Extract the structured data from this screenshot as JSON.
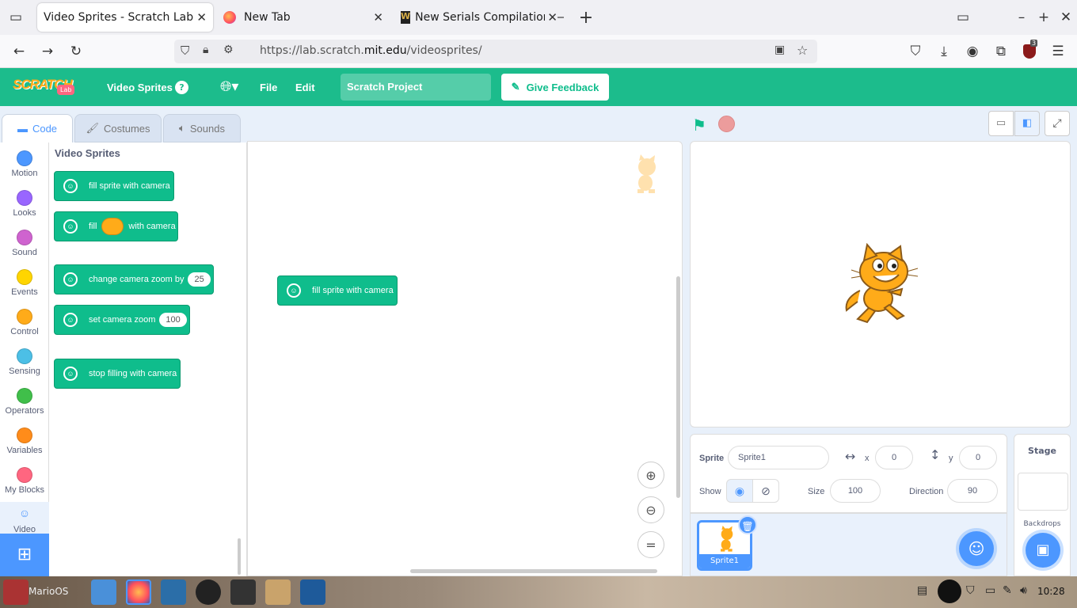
{
  "browser": {
    "tabs": [
      {
        "label": "Video Sprites - Scratch Lab",
        "active": true
      },
      {
        "label": "New Tab",
        "active": false
      },
      {
        "label": "New Serials Compilation — ",
        "active": false
      }
    ],
    "url_prefix": "https://lab.scratch.",
    "url_domain": "mit.edu",
    "url_path": "/videosprites/",
    "extension_badge": "3"
  },
  "menu": {
    "logo_text": "SCRATCH",
    "logo_badge": "Lab",
    "project_label": "Video Sprites",
    "help": "?",
    "file": "File",
    "edit": "Edit",
    "project_title": "Scratch Project",
    "feedback": "Give Feedback"
  },
  "editor_tabs": {
    "code": "Code",
    "costumes": "Costumes",
    "sounds": "Sounds"
  },
  "categories": [
    {
      "label": "Motion",
      "color": "#4c97ff"
    },
    {
      "label": "Looks",
      "color": "#9966ff"
    },
    {
      "label": "Sound",
      "color": "#cf63cf"
    },
    {
      "label": "Events",
      "color": "#ffd500"
    },
    {
      "label": "Control",
      "color": "#ffab19"
    },
    {
      "label": "Sensing",
      "color": "#4cbfe6"
    },
    {
      "label": "Operators",
      "color": "#40bf4a"
    },
    {
      "label": "Variables",
      "color": "#ff8c1a"
    },
    {
      "label": "My Blocks",
      "color": "#ff6680"
    },
    {
      "label": "Video",
      "color": "#0fbd8c"
    }
  ],
  "palette": {
    "heading": "Video Sprites",
    "blocks": {
      "fill_sprite": "fill sprite with camera",
      "fill": "fill",
      "with_camera": "with camera",
      "change_zoom": "change camera zoom by",
      "change_zoom_value": "25",
      "set_zoom": "set camera zoom",
      "set_zoom_value": "100",
      "stop_filling": "stop filling with camera"
    }
  },
  "workspace": {
    "script_block": "fill sprite with camera",
    "zoom_reset": "="
  },
  "sprite_info": {
    "sprite_label": "Sprite",
    "sprite_name": "Sprite1",
    "x_label": "x",
    "x_value": "0",
    "y_label": "y",
    "y_value": "0",
    "show_label": "Show",
    "size_label": "Size",
    "size_value": "100",
    "direction_label": "Direction",
    "direction_value": "90"
  },
  "sprite_list": [
    {
      "name": "Sprite1"
    }
  ],
  "stage_panel": {
    "title": "Stage",
    "backdrops": "Backdrops"
  },
  "taskbar": {
    "start_label": "MarioOS",
    "clock": "10:28"
  },
  "colors": {
    "accent_green": "#0fbd8c",
    "menu_green": "#1cbc8c",
    "blue": "#4c97ff"
  }
}
